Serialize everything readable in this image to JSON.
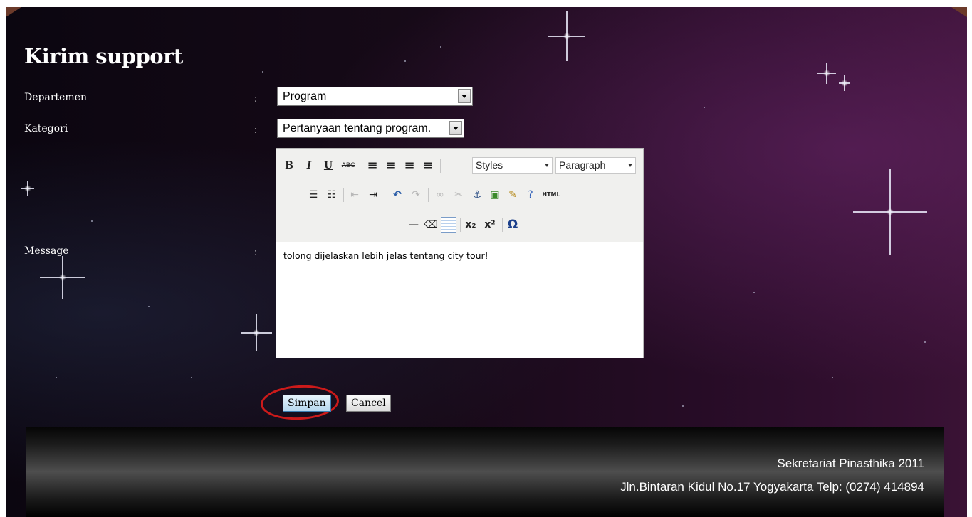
{
  "page": {
    "title": "Kirim support"
  },
  "form": {
    "departemen": {
      "label": "Departemen",
      "colon": ":",
      "value": "Program"
    },
    "kategori": {
      "label": "Kategori",
      "colon": ":",
      "value": "Pertanyaan tentang program."
    },
    "message": {
      "label": "Message",
      "colon": ":",
      "content": "tolong dijelaskan lebih jelas tentang city tour!"
    }
  },
  "editor": {
    "toolbar": {
      "row1": [
        {
          "name": "bold-icon",
          "glyph": "B"
        },
        {
          "name": "italic-icon",
          "glyph": "I"
        },
        {
          "name": "underline-icon",
          "glyph": "U"
        },
        {
          "name": "strikethrough-icon",
          "glyph": "ABC"
        },
        {
          "name": "align-left-icon",
          "glyph": "≡"
        },
        {
          "name": "align-center-icon",
          "glyph": "≡"
        },
        {
          "name": "align-right-icon",
          "glyph": "≡"
        },
        {
          "name": "align-justify-icon",
          "glyph": "≡"
        }
      ],
      "styles_label": "Styles",
      "format_label": "Paragraph",
      "html_label": "HTML"
    }
  },
  "actions": {
    "save_label": "Simpan",
    "cancel_label": "Cancel"
  },
  "footer": {
    "line1": "Sekretariat Pinasthika 2011",
    "line2": "Jln.Bintaran Kidul No.17 Yogyakarta Telp: (0274) 414894"
  },
  "colors": {
    "highlight_ring": "#cc1a1a",
    "background_space": "#170a18",
    "footer_gradient_mid": "#4e4e4e"
  }
}
